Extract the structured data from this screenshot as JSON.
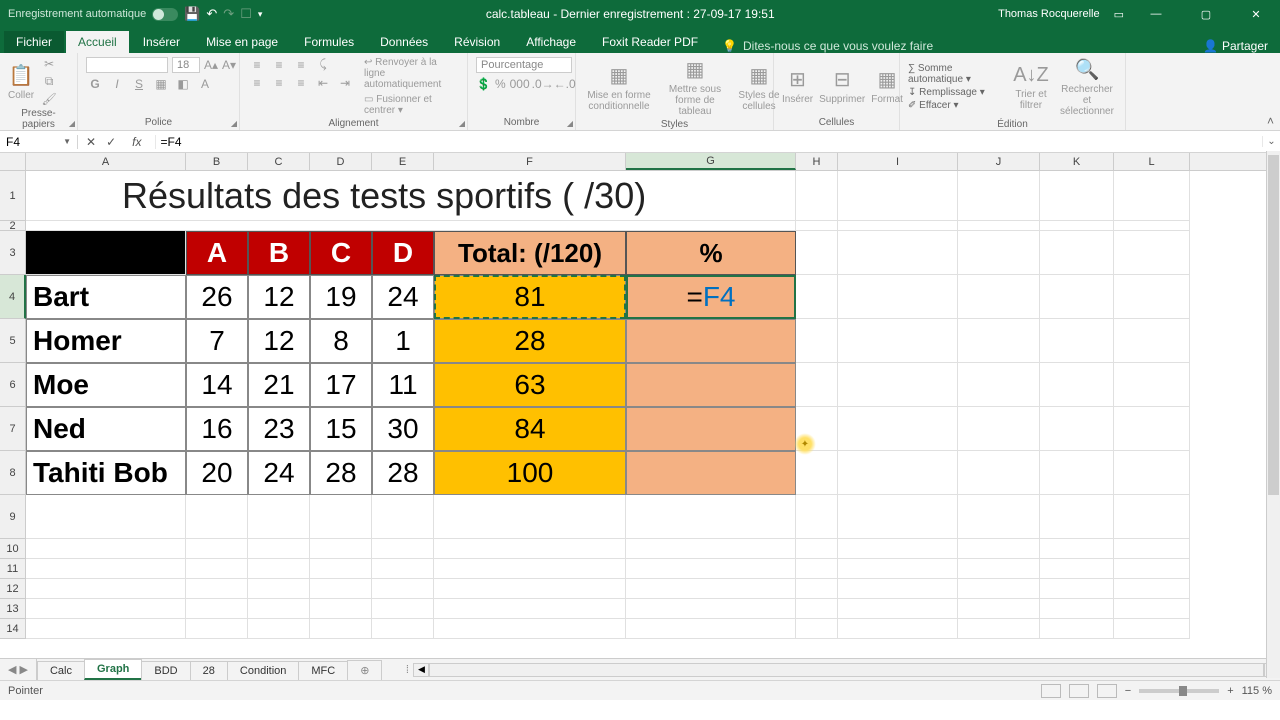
{
  "titlebar": {
    "autosave_label": "Enregistrement automatique",
    "doc_title": "calc.tableau - Dernier enregistrement : 27-09-17 19:51",
    "user": "Thomas Rocquerelle"
  },
  "window": {
    "minimize": "—",
    "restore": "▢",
    "close": "✕"
  },
  "tabs": {
    "file": "Fichier",
    "home": "Accueil",
    "insert": "Insérer",
    "layout": "Mise en page",
    "formulas": "Formules",
    "data": "Données",
    "review": "Révision",
    "view": "Affichage",
    "foxit": "Foxit Reader PDF",
    "tellme": "Dites-nous ce que vous voulez faire",
    "share": "Partager"
  },
  "ribbon": {
    "clipboard": {
      "paste": "Coller",
      "label": "Presse-papiers"
    },
    "font": {
      "name": "",
      "size": "18",
      "label": "Police"
    },
    "alignment": {
      "wrap": "Renvoyer à la ligne automatiquement",
      "merge": "Fusionner et centrer",
      "label": "Alignement"
    },
    "number": {
      "format": "Pourcentage",
      "label": "Nombre"
    },
    "styles": {
      "cond": "Mise en forme conditionnelle",
      "table": "Mettre sous forme de tableau",
      "cell": "Styles de cellules",
      "label": "Styles"
    },
    "cells": {
      "insert": "Insérer",
      "delete": "Supprimer",
      "format": "Format",
      "label": "Cellules"
    },
    "editing": {
      "autosum": "Somme automatique",
      "fill": "Remplissage",
      "clear": "Effacer",
      "sort": "Trier et filtrer",
      "find": "Rechercher et sélectionner",
      "label": "Édition"
    }
  },
  "namebox": "F4",
  "formula": {
    "text_eq": "=",
    "text_ref": "F4"
  },
  "columns": [
    "A",
    "B",
    "C",
    "D",
    "E",
    "F",
    "G",
    "H",
    "I",
    "J",
    "K",
    "L"
  ],
  "grid": {
    "title": "Résultats des tests sportifs ( /30)",
    "headers": {
      "a": "A",
      "b": "B",
      "c": "C",
      "d": "D",
      "total": "Total: (/120)",
      "pct": "%"
    },
    "rows": [
      {
        "name": "Bart",
        "a": "26",
        "b": "12",
        "c": "19",
        "d": "24",
        "total": "81",
        "pct_eq": "=",
        "pct_ref": "F4"
      },
      {
        "name": "Homer",
        "a": "7",
        "b": "12",
        "c": "8",
        "d": "1",
        "total": "28",
        "pct": ""
      },
      {
        "name": "Moe",
        "a": "14",
        "b": "21",
        "c": "17",
        "d": "11",
        "total": "63",
        "pct": ""
      },
      {
        "name": "Ned",
        "a": "16",
        "b": "23",
        "c": "15",
        "d": "30",
        "total": "84",
        "pct": ""
      },
      {
        "name": "Tahiti Bob",
        "a": "20",
        "b": "24",
        "c": "28",
        "d": "28",
        "total": "100",
        "pct": ""
      }
    ]
  },
  "sheets": {
    "tabs": [
      "Calc",
      "Graph",
      "BDD",
      "28",
      "Condition",
      "MFC"
    ],
    "active": 1
  },
  "status": {
    "mode": "Pointer",
    "zoom": "115 %"
  }
}
